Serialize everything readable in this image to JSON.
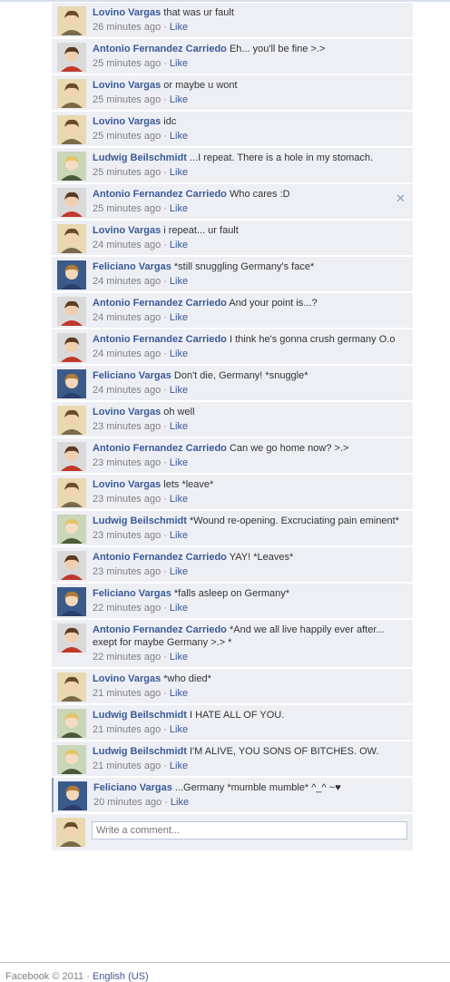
{
  "comments": [
    {
      "author": "Lovino Vargas",
      "text": "that was ur fault",
      "time": "26 minutes ago",
      "like": "Like",
      "avatar": "lovino-avatar"
    },
    {
      "author": "Antonio Fernandez Carriedo",
      "text": "Eh... you'll be fine >.>",
      "time": "25 minutes ago",
      "like": "Like",
      "avatar": "antonio-avatar"
    },
    {
      "author": "Lovino Vargas",
      "text": "or maybe u wont",
      "time": "25 minutes ago",
      "like": "Like",
      "avatar": "lovino-avatar"
    },
    {
      "author": "Lovino Vargas",
      "text": "idc",
      "time": "25 minutes ago",
      "like": "Like",
      "avatar": "lovino-avatar"
    },
    {
      "author": "Ludwig Beilschmidt",
      "text": "...I repeat. There is a hole in my stomach.",
      "time": "25 minutes ago",
      "like": "Like",
      "avatar": "ludwig-avatar"
    },
    {
      "author": "Antonio Fernandez Carriedo",
      "text": "Who cares :D",
      "time": "25 minutes ago",
      "like": "Like",
      "avatar": "antonio-avatar",
      "close": "✕"
    },
    {
      "author": "Lovino Vargas",
      "text": "i repeat... ur fault",
      "time": "24 minutes ago",
      "like": "Like",
      "avatar": "lovino-avatar"
    },
    {
      "author": "Feliciano Vargas",
      "text": "*still snuggling Germany's face*",
      "time": "24 minutes ago",
      "like": "Like",
      "avatar": "feliciano-avatar"
    },
    {
      "author": "Antonio Fernandez Carriedo",
      "text": "And your point is...?",
      "time": "24 minutes ago",
      "like": "Like",
      "avatar": "antonio-avatar"
    },
    {
      "author": "Antonio Fernandez Carriedo",
      "text": "I think he's gonna crush germany O.o",
      "time": "24 minutes ago",
      "like": "Like",
      "avatar": "antonio-avatar"
    },
    {
      "author": "Feliciano Vargas",
      "text": "Don't die, Germany! *snuggle*",
      "time": "24 minutes ago",
      "like": "Like",
      "avatar": "feliciano-avatar"
    },
    {
      "author": "Lovino Vargas",
      "text": "oh well",
      "time": "23 minutes ago",
      "like": "Like",
      "avatar": "lovino-avatar"
    },
    {
      "author": "Antonio Fernandez Carriedo",
      "text": "Can we go home now? >.>",
      "time": "23 minutes ago",
      "like": "Like",
      "avatar": "antonio-avatar"
    },
    {
      "author": "Lovino Vargas",
      "text": "lets *leave*",
      "time": "23 minutes ago",
      "like": "Like",
      "avatar": "lovino-avatar"
    },
    {
      "author": "Ludwig Beilschmidt",
      "text": "*Wound re-opening. Excruciating pain eminent*",
      "time": "23 minutes ago",
      "like": "Like",
      "avatar": "ludwig-avatar"
    },
    {
      "author": "Antonio Fernandez Carriedo",
      "text": "YAY! *Leaves*",
      "time": "23 minutes ago",
      "like": "Like",
      "avatar": "antonio-avatar"
    },
    {
      "author": "Feliciano Vargas",
      "text": "*falls asleep on Germany*",
      "time": "22 minutes ago",
      "like": "Like",
      "avatar": "feliciano-avatar"
    },
    {
      "author": "Antonio Fernandez Carriedo",
      "text": "*And we all live happily ever after... exept for maybe Germany >.> *",
      "time": "22 minutes ago",
      "like": "Like",
      "avatar": "antonio-avatar"
    },
    {
      "author": "Lovino Vargas",
      "text": "*who died*",
      "time": "21 minutes ago",
      "like": "Like",
      "avatar": "lovino-avatar"
    },
    {
      "author": "Ludwig Beilschmidt",
      "text": "I HATE ALL OF YOU.",
      "time": "21 minutes ago",
      "like": "Like",
      "avatar": "ludwig-avatar"
    },
    {
      "author": "Ludwig Beilschmidt",
      "text": "I'M ALIVE, YOU SONS OF BITCHES. OW.",
      "time": "21 minutes ago",
      "like": "Like",
      "avatar": "ludwig-avatar"
    },
    {
      "author": "Feliciano Vargas",
      "text": "...Germany *mumble mumble* ^_^ ~♥",
      "time": "20 minutes ago",
      "like": "Like",
      "avatar": "feliciano-avatar"
    }
  ],
  "composer": {
    "placeholder": "Write a comment...",
    "avatar": "user-avatar"
  },
  "footer": {
    "copyright": "Facebook © 2011 ·",
    "language": "English (US)"
  },
  "colors": {
    "link": "#3b5998",
    "comment_bg": "#edeff4",
    "meta": "#808080"
  }
}
